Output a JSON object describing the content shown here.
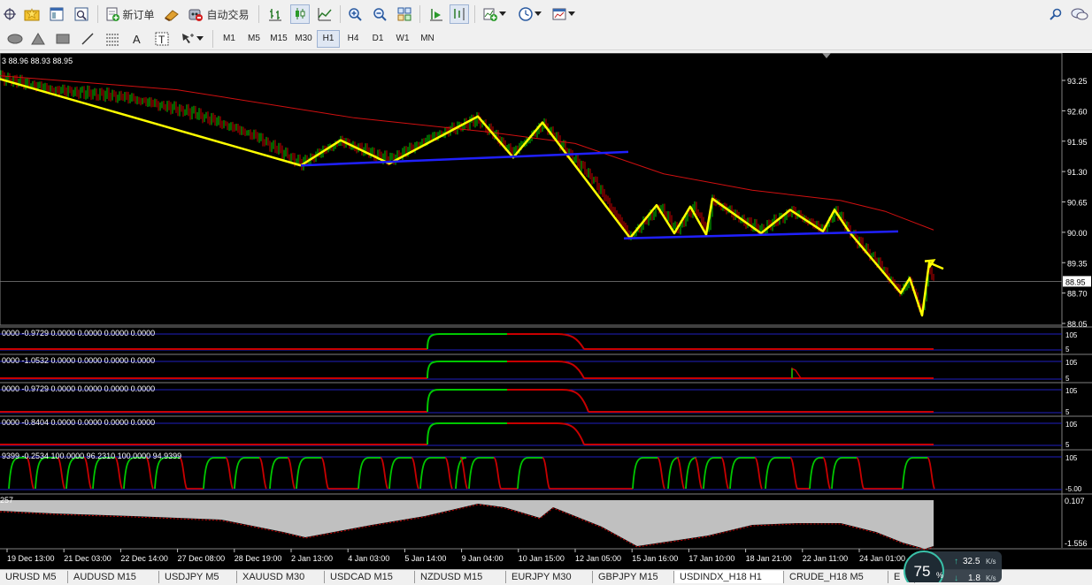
{
  "toolbar": {
    "new_order_label": "新订单",
    "auto_trading_label": "自动交易",
    "timeframes": [
      "M1",
      "M5",
      "M15",
      "M30",
      "H1",
      "H4",
      "D1",
      "W1",
      "MN"
    ],
    "active_timeframe": "H1"
  },
  "chart": {
    "ohlc_readout": "3 88.96 88.93 88.95",
    "current_price": "88.95",
    "price_ticks": [
      "93.25",
      "92.60",
      "91.95",
      "91.30",
      "90.65",
      "90.00",
      "89.35",
      "88.70",
      "88.05"
    ],
    "time_ticks": [
      "19 Dec 13:00",
      "21 Dec 03:00",
      "22 Dec 14:00",
      "27 Dec 08:00",
      "28 Dec 19:00",
      "2 Jan 13:00",
      "4 Jan 03:00",
      "5 Jan 14:00",
      "9 Jan 04:00",
      "10 Jan 15:00",
      "12 Jan 05:00",
      "15 Jan 16:00",
      "17 Jan 10:00",
      "18 Jan 21:00",
      "22 Jan 11:00",
      "24 Jan 01:00"
    ],
    "indicator_readouts": [
      "0000 -0.9729 0.0000 0.0000 0.0000 0.0000",
      "0000 -1.0532 0.0000 0.0000 0.0000 0.0000",
      "0000 -0.9729 0.0000 0.0000 0.0000 0.0000",
      "0000 -0.8404 0.0000 0.0000 0.0000 0.0000",
      "9399 -0.2534 100.0000 96.2310 100.0000 94.9399",
      "257"
    ],
    "sub_scale_top": "105",
    "sub_scale_mid": "5",
    "sub_scale_bottom": "-5.00",
    "hist_top_label": "0.107",
    "hist_bottom_label": "-1.556",
    "colors": {
      "background": "#000000",
      "up_bar": "#00c800",
      "down_bar": "#c80000",
      "moving_average": "#d01010",
      "pattern_line": "#ffff00",
      "neckline": "#2020ff",
      "histogram": "#c0c0c0"
    }
  },
  "tabs": [
    "URUSD M5",
    "AUDUSD M15",
    "USDJPY M5",
    "XAUUSD M30",
    "USDCAD M15",
    "NZDUSD M15",
    "EURJPY M30",
    "GBPJPY M15",
    "USDINDX_H18 H1",
    "CRUDE_H18 M5",
    "E"
  ],
  "active_tab": "USDINDX_H18 H1",
  "network": {
    "percent": "75",
    "percent_unit": "%",
    "upload": "32.5",
    "download": "1.8",
    "unit": "K/s"
  }
}
